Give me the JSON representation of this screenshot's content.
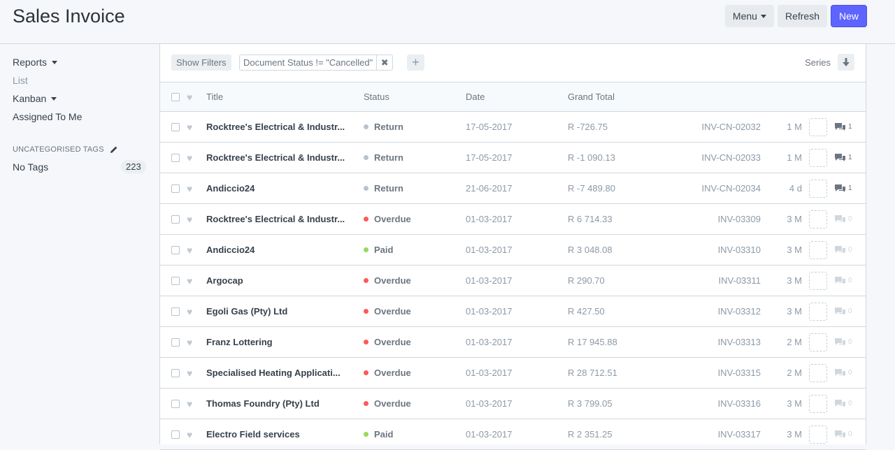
{
  "header": {
    "title": "Sales Invoice",
    "menu_label": "Menu",
    "refresh_label": "Refresh",
    "new_label": "New"
  },
  "sidebar": {
    "reports": "Reports",
    "list": "List",
    "kanban": "Kanban",
    "assigned": "Assigned To Me",
    "tags_heading": "UNCATEGORISED TAGS",
    "no_tags": "No Tags",
    "no_tags_count": "223"
  },
  "filters": {
    "show_filters": "Show Filters",
    "active_filter": "Document Status != \"Cancelled\"",
    "series_label": "Series"
  },
  "columns": {
    "title": "Title",
    "status": "Status",
    "date": "Date",
    "grand_total": "Grand Total"
  },
  "status_colors": {
    "Return": "#b8c2cc",
    "Overdue": "#ff5858",
    "Paid": "#98d85b"
  },
  "rows": [
    {
      "title": "Rocktree's Electrical & Industr...",
      "status": "Return",
      "date": "17-05-2017",
      "total": "R -726.75",
      "name": "INV-CN-02032",
      "age": "1 M",
      "comments": "1"
    },
    {
      "title": "Rocktree's Electrical & Industr...",
      "status": "Return",
      "date": "17-05-2017",
      "total": "R -1 090.13",
      "name": "INV-CN-02033",
      "age": "1 M",
      "comments": "1"
    },
    {
      "title": "Andiccio24",
      "status": "Return",
      "date": "21-06-2017",
      "total": "R -7 489.80",
      "name": "INV-CN-02034",
      "age": "4 d",
      "comments": "1"
    },
    {
      "title": "Rocktree's Electrical & Industr...",
      "status": "Overdue",
      "date": "01-03-2017",
      "total": "R 6 714.33",
      "name": "INV-03309",
      "age": "3 M",
      "comments": "0"
    },
    {
      "title": "Andiccio24",
      "status": "Paid",
      "date": "01-03-2017",
      "total": "R 3 048.08",
      "name": "INV-03310",
      "age": "3 M",
      "comments": "0"
    },
    {
      "title": "Argocap",
      "status": "Overdue",
      "date": "01-03-2017",
      "total": "R 290.70",
      "name": "INV-03311",
      "age": "3 M",
      "comments": "0"
    },
    {
      "title": "Egoli Gas (Pty) Ltd",
      "status": "Overdue",
      "date": "01-03-2017",
      "total": "R 427.50",
      "name": "INV-03312",
      "age": "3 M",
      "comments": "0"
    },
    {
      "title": "Franz Lottering",
      "status": "Overdue",
      "date": "01-03-2017",
      "total": "R 17 945.88",
      "name": "INV-03313",
      "age": "2 M",
      "comments": "0"
    },
    {
      "title": "Specialised Heating Applicati...",
      "status": "Overdue",
      "date": "01-03-2017",
      "total": "R 28 712.51",
      "name": "INV-03315",
      "age": "2 M",
      "comments": "0"
    },
    {
      "title": "Thomas Foundry (Pty) Ltd",
      "status": "Overdue",
      "date": "01-03-2017",
      "total": "R 3 799.05",
      "name": "INV-03316",
      "age": "3 M",
      "comments": "0"
    },
    {
      "title": "Electro Field services",
      "status": "Paid",
      "date": "01-03-2017",
      "total": "R 2 351.25",
      "name": "INV-03317",
      "age": "3 M",
      "comments": "0"
    }
  ]
}
